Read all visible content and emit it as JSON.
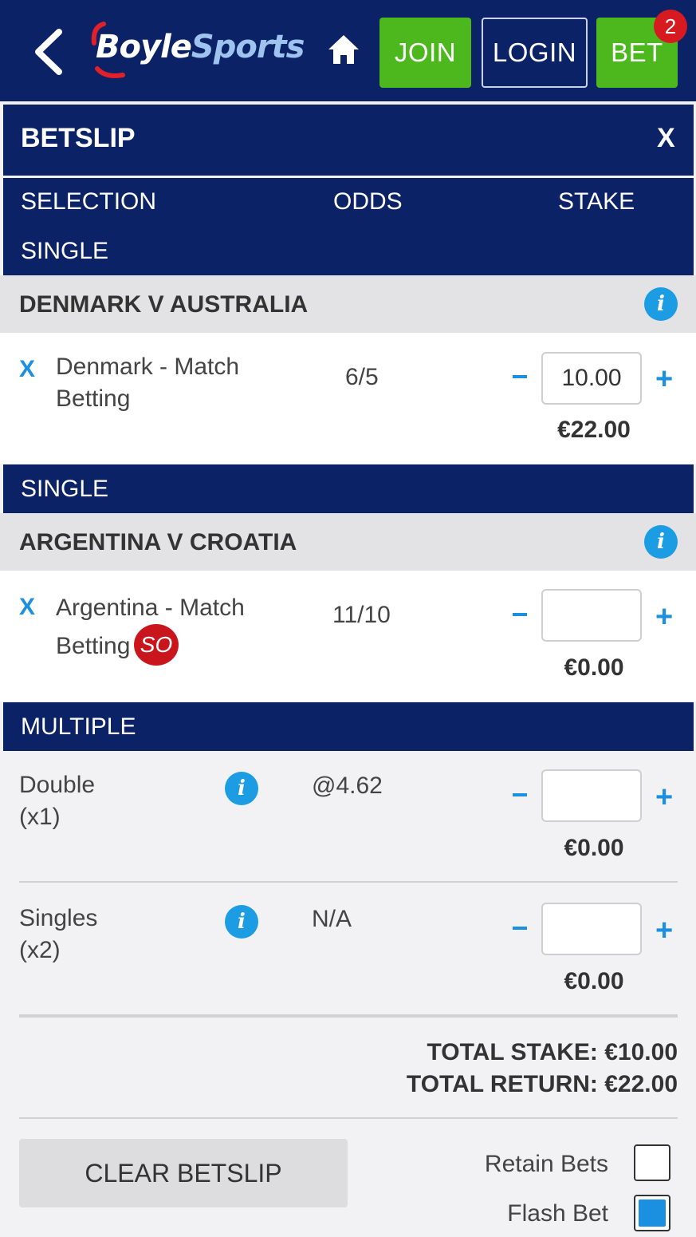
{
  "header": {
    "logo_part1": "Boyle",
    "logo_part2": "Sports",
    "join_label": "JOIN",
    "login_label": "LOGIN",
    "bet_label": "BET",
    "bet_count": "2"
  },
  "betslip": {
    "title": "BETSLIP",
    "close_label": "X",
    "columns": {
      "selection": "SELECTION",
      "odds": "ODDS",
      "stake": "STAKE"
    }
  },
  "singles": [
    {
      "section_label": "SINGLE",
      "event": "DENMARK V AUSTRALIA",
      "remove_label": "X",
      "selection_line1": "Denmark - Match",
      "selection_line2": "Betting",
      "odds": "6/5",
      "minus": "-",
      "stake": "10.00",
      "plus": "+",
      "return": "€22.00"
    },
    {
      "section_label": "SINGLE",
      "event": "ARGENTINA V CROATIA",
      "remove_label": "X",
      "selection_line1": "Argentina - Match",
      "selection_line2": "Betting",
      "badge": "SO",
      "odds": "11/10",
      "minus": "-",
      "stake": "",
      "plus": "+",
      "return": "€0.00"
    }
  ],
  "multiple": {
    "section_label": "MULTIPLE",
    "rows": [
      {
        "name_line1": "Double",
        "name_line2": "(x1)",
        "odds": "@4.62",
        "stake": "",
        "return": "€0.00"
      },
      {
        "name_line1": "Singles",
        "name_line2": "(x2)",
        "odds": "N/A",
        "stake": "",
        "return": "€0.00"
      }
    ]
  },
  "totals": {
    "stake_label": "TOTAL STAKE: €10.00",
    "return_label": "TOTAL RETURN: €22.00"
  },
  "footer": {
    "clear_label": "CLEAR BETSLIP",
    "retain_label": "Retain Bets",
    "retain_checked": false,
    "flash_label": "Flash Bet",
    "flash_checked": true
  },
  "icons": {
    "info": "i",
    "colors": {
      "navy": "#0b2266",
      "green": "#4cb81e",
      "blue": "#1b8fe0",
      "red": "#d71920"
    }
  }
}
